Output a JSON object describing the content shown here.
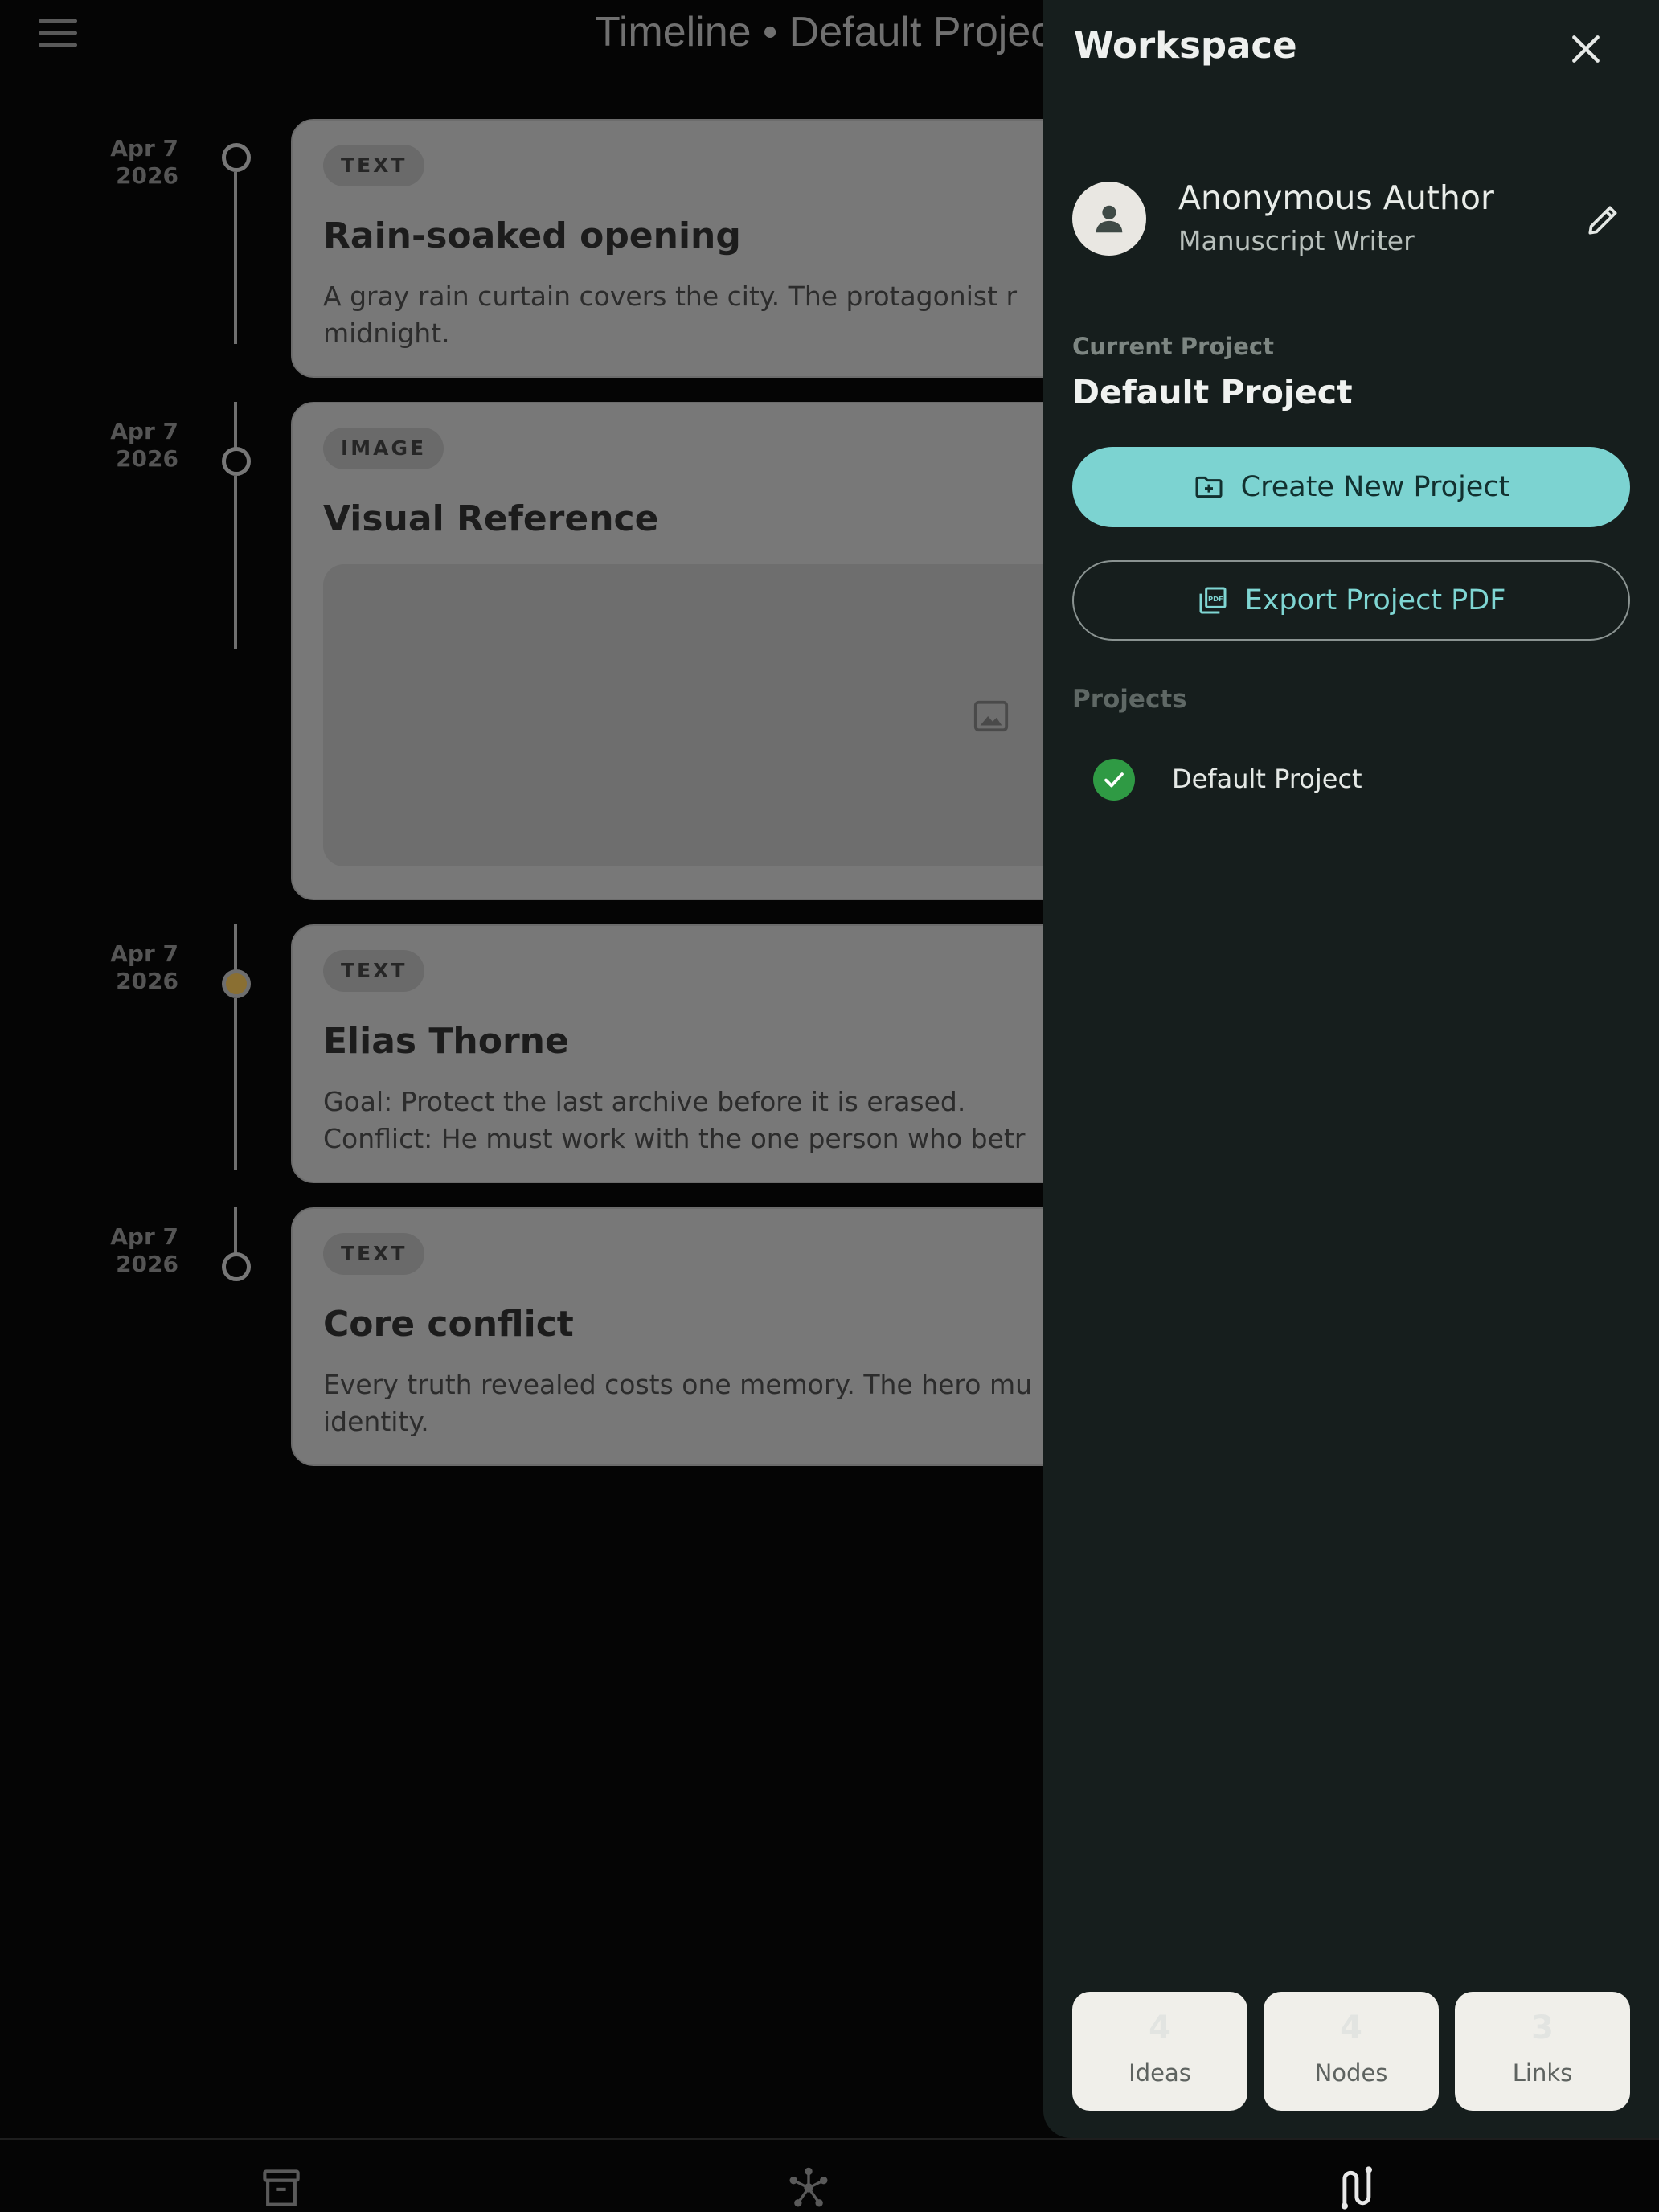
{
  "header": {
    "title": "Timeline • Default Project"
  },
  "timeline": [
    {
      "date_line1": "Apr 7",
      "date_line2": "2026",
      "type": "TEXT",
      "title": "Rain-soaked opening",
      "body": "A gray rain curtain covers the city. The protagonist r\nmidnight."
    },
    {
      "date_line1": "Apr 7",
      "date_line2": "2026",
      "type": "IMAGE",
      "title": "Visual Reference",
      "body": ""
    },
    {
      "date_line1": "Apr 7",
      "date_line2": "2026",
      "type": "TEXT",
      "title": "Elias Thorne",
      "body": "Goal: Protect the last archive before it is erased.\nConflict: He must work with the one person who betr"
    },
    {
      "date_line1": "Apr 7",
      "date_line2": "2026",
      "type": "TEXT",
      "title": "Core conflict",
      "body": "Every truth revealed costs one memory. The hero mu\nidentity."
    }
  ],
  "drawer": {
    "title": "Workspace",
    "user": {
      "name": "Anonymous Author",
      "role": "Manuscript Writer"
    },
    "current_project_label": "Current Project",
    "current_project": "Default Project",
    "create_label": "Create New Project",
    "export_label": "Export Project PDF",
    "projects_label": "Projects",
    "projects": [
      {
        "name": "Default Project",
        "selected": true
      }
    ],
    "stats": [
      {
        "value": "4",
        "label": "Ideas"
      },
      {
        "value": "4",
        "label": "Nodes"
      },
      {
        "value": "3",
        "label": "Links"
      }
    ]
  },
  "colors": {
    "accent": "#7cd3d1",
    "drawer_bg": "#161e1d",
    "check": "#2f9a44",
    "dot_accent": "#8a6f32"
  },
  "icons": {
    "menu": "hamburger-icon",
    "close": "close-icon",
    "edit": "pencil-icon",
    "create": "folder-plus-icon",
    "export": "pdf-icon",
    "nav": [
      "archive-icon",
      "graph-icon",
      "timeline-icon"
    ]
  }
}
